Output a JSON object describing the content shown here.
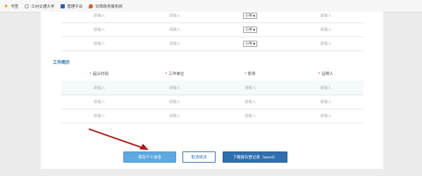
{
  "bookmarks": [
    {
      "label": "书签",
      "icon": "star-icon"
    },
    {
      "label": "兰州交通大学",
      "icon": "globe-icon"
    },
    {
      "label": "管理平台",
      "icon": "app-icon"
    },
    {
      "label": "甘肃政务服务网",
      "icon": "flame-icon"
    }
  ],
  "family_rows": [
    {
      "c1": "请输入",
      "c2": "请输入",
      "select": "小学",
      "c4": "请输入"
    },
    {
      "c1": "请输入",
      "c2": "请输入",
      "select": "小学",
      "c4": "请输入"
    },
    {
      "c1": "请输入",
      "c2": "请输入",
      "select": "小学",
      "c4": "请输入"
    }
  ],
  "work_section": {
    "title": "工作简历",
    "headers": [
      "起止时间",
      "工作单位",
      "职务",
      "证明人"
    ],
    "rows": [
      [
        "请输入",
        "请输入",
        "请输入",
        "请输入"
      ],
      [
        "请输入",
        "请输入",
        "请输入",
        "请输入"
      ],
      [
        "请输入",
        "请输入",
        "请输入",
        "请输入"
      ]
    ]
  },
  "buttons": {
    "save": "保存个人信息",
    "cancel": "取消修改",
    "download": "下载报名登记表（word）"
  },
  "colors": {
    "accent": "#1f6fb0",
    "annotation_arrow": "#b01b1b"
  }
}
